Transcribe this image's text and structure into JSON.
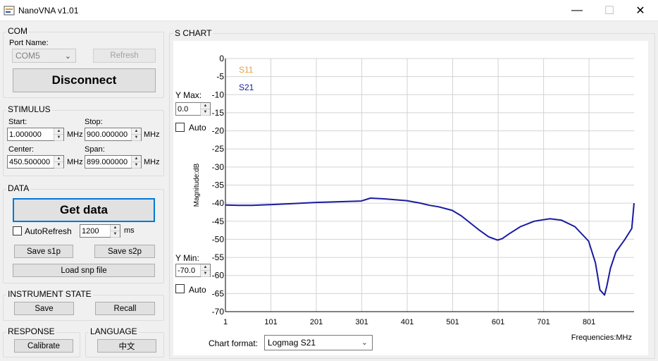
{
  "window": {
    "title": "NanoVNA v1.01",
    "minimize_glyph": "—",
    "maximize_glyph": "☐",
    "close_glyph": "✕"
  },
  "com": {
    "group_label": "COM",
    "port_label": "Port Name:",
    "port_value": "COM5",
    "refresh_label": "Refresh",
    "disconnect_label": "Disconnect"
  },
  "stimulus": {
    "group_label": "STIMULUS",
    "start_label": "Start:",
    "start_value": "1.000000",
    "stop_label": "Stop:",
    "stop_value": "900.000000",
    "center_label": "Center:",
    "center_value": "450.500000",
    "span_label": "Span:",
    "span_value": "899.000000",
    "unit": "MHz"
  },
  "data_group": {
    "group_label": "DATA",
    "get_data_label": "Get data",
    "auto_refresh_label": "AutoRefresh",
    "interval_value": "1200",
    "interval_unit": "ms",
    "save_s1p_label": "Save s1p",
    "save_s2p_label": "Save s2p",
    "load_snp_label": "Load snp file"
  },
  "instrument": {
    "group_label": "INSTRUMENT STATE",
    "save_label": "Save",
    "recall_label": "Recall"
  },
  "response": {
    "group_label": "RESPONSE",
    "calibrate_label": "Calibrate"
  },
  "language": {
    "group_label": "LANGUAGE",
    "button_label": "中文"
  },
  "chart_panel": {
    "group_label": "S CHART",
    "ymax_label": "Y Max:",
    "ymax_value": "0.0",
    "ymin_label": "Y Min:",
    "ymin_value": "-70.0",
    "auto_label": "Auto",
    "chart_format_label": "Chart format:",
    "chart_format_value": "Logmag S21"
  },
  "colors": {
    "s11": "#e8a040",
    "s21": "#1a1aa0",
    "grid": "#d3d3d3"
  },
  "chart_data": {
    "type": "line",
    "title": "",
    "xlabel": "Frequencies:MHz",
    "ylabel": "Magnitude:dB",
    "xlim": [
      1,
      900
    ],
    "ylim": [
      -70,
      0
    ],
    "x_ticks": [
      1,
      101,
      201,
      301,
      401,
      501,
      601,
      701,
      801
    ],
    "y_ticks": [
      0,
      -5,
      -10,
      -15,
      -20,
      -25,
      -30,
      -35,
      -40,
      -45,
      -50,
      -55,
      -60,
      -65,
      -70
    ],
    "legend_position": "top-left",
    "grid": true,
    "series": [
      {
        "name": "S11",
        "color": "#e8a040",
        "x": [],
        "y": []
      },
      {
        "name": "S21",
        "color": "#1a1aa0",
        "x": [
          1,
          30,
          60,
          100,
          150,
          200,
          250,
          300,
          310,
          320,
          350,
          400,
          430,
          450,
          470,
          500,
          520,
          540,
          560,
          580,
          595,
          600,
          610,
          625,
          650,
          680,
          700,
          715,
          740,
          770,
          800,
          815,
          825,
          835,
          840,
          848,
          860,
          880,
          895,
          900
        ],
        "y": [
          -40.5,
          -40.6,
          -40.6,
          -40.4,
          -40.1,
          -39.8,
          -39.6,
          -39.4,
          -39.0,
          -38.6,
          -38.8,
          -39.3,
          -40.0,
          -40.6,
          -41.0,
          -42.0,
          -43.5,
          -45.5,
          -47.5,
          -49.3,
          -50.0,
          -50.2,
          -49.8,
          -48.5,
          -46.5,
          -45.0,
          -44.6,
          -44.3,
          -44.7,
          -46.5,
          -50.5,
          -56.5,
          -64.0,
          -65.4,
          -63.0,
          -58.0,
          -53.5,
          -50.0,
          -47.0,
          -40.0
        ]
      }
    ]
  }
}
